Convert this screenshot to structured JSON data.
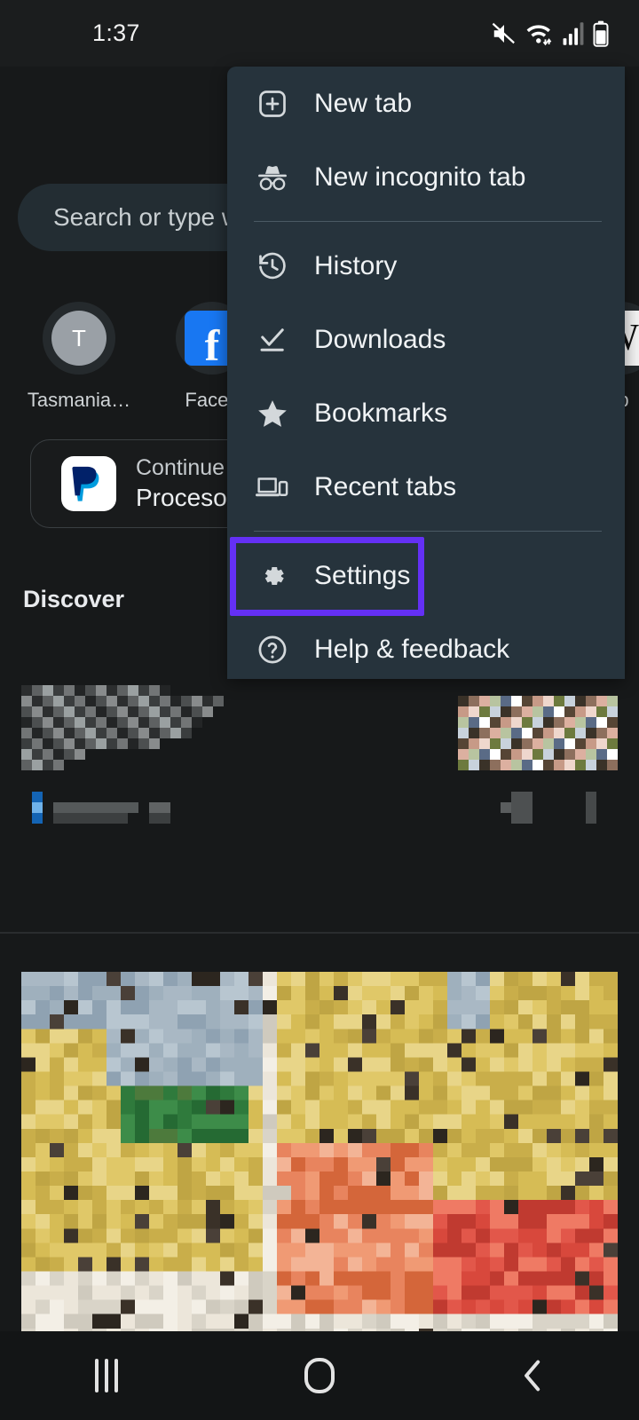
{
  "status_bar": {
    "clock": "1:37",
    "icons": [
      {
        "name": "mute-icon",
        "label": "Sound muted"
      },
      {
        "name": "wifi-icon",
        "label": "Wi-Fi connected"
      },
      {
        "name": "signal-icon",
        "label": "Mobile signal"
      },
      {
        "name": "battery-icon",
        "label": "Battery"
      }
    ]
  },
  "ntp": {
    "search": {
      "placeholder": "Search or type w"
    },
    "shortcuts": [
      {
        "label": "Tasmania…",
        "icon": "avatar-letter",
        "glyph": "T"
      },
      {
        "label": "Faceb",
        "icon": "facebook-icon",
        "glyph": "f"
      },
      {
        "label": "ip",
        "icon": "wikipedia-icon",
        "glyph": "W"
      }
    ],
    "continue_card": {
      "icon": "paypal-icon",
      "title": "Continue brow",
      "subtitle": "Proceso de"
    },
    "discover_heading": "Discover"
  },
  "menu": {
    "items": [
      {
        "id": "new-tab",
        "label": "New tab",
        "icon": "new-tab-icon"
      },
      {
        "id": "new-incognito",
        "label": "New incognito tab",
        "icon": "incognito-icon"
      },
      {
        "id": "history",
        "label": "History",
        "icon": "history-icon"
      },
      {
        "id": "downloads",
        "label": "Downloads",
        "icon": "download-icon"
      },
      {
        "id": "bookmarks",
        "label": "Bookmarks",
        "icon": "star-icon"
      },
      {
        "id": "recent-tabs",
        "label": "Recent tabs",
        "icon": "devices-icon"
      },
      {
        "id": "settings",
        "label": "Settings",
        "icon": "gear-icon"
      },
      {
        "id": "help-feedback",
        "label": "Help & feedback",
        "icon": "help-circle-icon"
      }
    ],
    "highlight": {
      "target": "Settings",
      "color": "#6430f5"
    }
  },
  "nav_bar": {
    "recents_label": "Recents",
    "home_label": "Home",
    "back_label": "Back"
  },
  "colors": {
    "page_background": "#17191a",
    "menu_background": "#26333c",
    "search_background": "#232d33",
    "highlight_purple": "#6430f5",
    "text_primary": "#f0f3f5"
  }
}
